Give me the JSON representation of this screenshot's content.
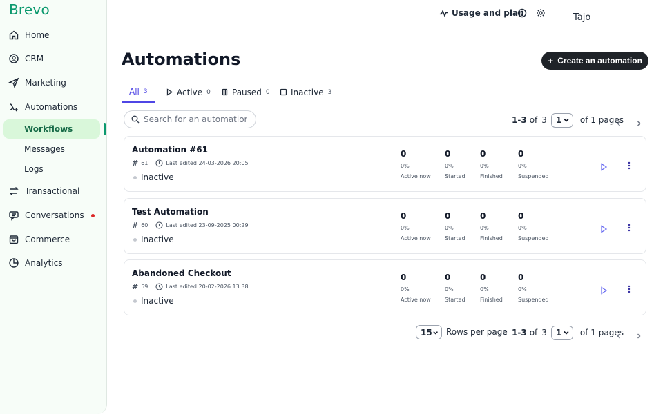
{
  "brand": {
    "logo_text": "Brevo",
    "accent_color": "#0b996e",
    "primary_color": "#4f46e5"
  },
  "sidebar": {
    "items": [
      {
        "label": "Home",
        "icon": "home-icon"
      },
      {
        "label": "CRM",
        "icon": "contacts-icon"
      },
      {
        "label": "Marketing",
        "icon": "send-icon"
      },
      {
        "label": "Automations",
        "icon": "automation-icon"
      },
      {
        "label": "Transactional",
        "icon": "transactional-icon"
      },
      {
        "label": "Conversations",
        "icon": "chat-icon"
      },
      {
        "label": "Commerce",
        "icon": "bag-icon"
      },
      {
        "label": "Analytics",
        "icon": "chart-icon"
      }
    ],
    "subitems": [
      {
        "label": "Workflows",
        "active": true
      },
      {
        "label": "Messages",
        "active": false
      },
      {
        "label": "Logs",
        "active": false
      }
    ]
  },
  "header": {
    "usage_label": "Usage and plan",
    "help_icon": "help-icon",
    "settings_icon": "gear-icon",
    "user_name": "Tajo"
  },
  "page": {
    "title": "Automations",
    "create_label": "Create an automation"
  },
  "tabs": [
    {
      "label": "All",
      "count": "3",
      "active": true,
      "icon": ""
    },
    {
      "label": "Active",
      "count": "0",
      "active": false,
      "icon": "play-icon"
    },
    {
      "label": "Paused",
      "count": "0",
      "active": false,
      "icon": "pause-icon"
    },
    {
      "label": "Inactive",
      "count": "3",
      "active": false,
      "icon": "square-icon"
    }
  ],
  "search": {
    "placeholder": "Search for an automation"
  },
  "pagination": {
    "range": "1-3",
    "of_label": "of",
    "total": "3",
    "page": "1",
    "pages_label": "of  1 pages"
  },
  "rows_per_page": {
    "value": "15",
    "label": "Rows per page"
  },
  "stat_labels": [
    "Active now",
    "Started",
    "Finished",
    "Suspended"
  ],
  "automations": [
    {
      "name": "Automation #61",
      "id": "61",
      "edited": "Last edited 24-03-2026 20:05",
      "status": "Inactive",
      "stats": [
        {
          "value": "0",
          "pct": "0%"
        },
        {
          "value": "0",
          "pct": "0%"
        },
        {
          "value": "0",
          "pct": "0%"
        },
        {
          "value": "0",
          "pct": "0%"
        }
      ]
    },
    {
      "name": "Test Automation",
      "id": "60",
      "edited": "Last edited 23-09-2025 00:29",
      "status": "Inactive",
      "stats": [
        {
          "value": "0",
          "pct": "0%"
        },
        {
          "value": "0",
          "pct": "0%"
        },
        {
          "value": "0",
          "pct": "0%"
        },
        {
          "value": "0",
          "pct": "0%"
        }
      ]
    },
    {
      "name": "Abandoned Checkout",
      "id": "59",
      "edited": "Last edited 20-02-2026 13:38",
      "status": "Inactive",
      "stats": [
        {
          "value": "0",
          "pct": "0%"
        },
        {
          "value": "0",
          "pct": "0%"
        },
        {
          "value": "0",
          "pct": "0%"
        },
        {
          "value": "0",
          "pct": "0%"
        }
      ]
    }
  ]
}
